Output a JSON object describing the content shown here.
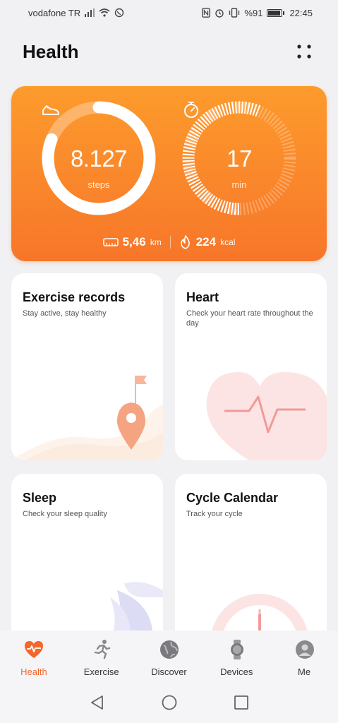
{
  "status_bar": {
    "carrier": "vodafone TR",
    "battery_percent": "%91",
    "battery_level": 0.91,
    "time": "22:45"
  },
  "header": {
    "title": "Health",
    "more_icon": "more-dots-icon"
  },
  "summary": {
    "steps_value": "8.127",
    "steps_unit": "steps",
    "steps_progress": 0.81,
    "steps_icon": "shoe-icon",
    "minutes_value": "17",
    "minutes_unit": "min",
    "minutes_progress": 0.57,
    "minutes_icon": "stopwatch-icon",
    "distance_value": "5,46",
    "distance_unit": "km",
    "distance_icon": "ruler-icon",
    "calories_value": "224",
    "calories_unit": "kcal",
    "calories_icon": "flame-icon"
  },
  "tiles": [
    {
      "title": "Exercise records",
      "subtitle": "Stay active, stay healthy",
      "icon": "location-flag-icon"
    },
    {
      "title": "Heart",
      "subtitle": "Check your heart rate throughout the day",
      "icon": "heart-pulse-icon"
    },
    {
      "title": "Sleep",
      "subtitle": "Check your sleep quality",
      "icon": "moon-cloud-icon"
    },
    {
      "title": "Cycle Calendar",
      "subtitle": "Track your cycle",
      "icon": "clock-icon"
    }
  ],
  "bottom_nav": [
    {
      "label": "Health",
      "icon": "heart-pulse-icon",
      "active": true
    },
    {
      "label": "Exercise",
      "icon": "running-person-icon",
      "active": false
    },
    {
      "label": "Discover",
      "icon": "globe-icon",
      "active": false
    },
    {
      "label": "Devices",
      "icon": "watch-icon",
      "active": false
    },
    {
      "label": "Me",
      "icon": "avatar-icon",
      "active": false
    }
  ],
  "colors": {
    "accent": "#f4662c",
    "card_top": "#fd9b2c",
    "card_bottom": "#f7762a"
  }
}
